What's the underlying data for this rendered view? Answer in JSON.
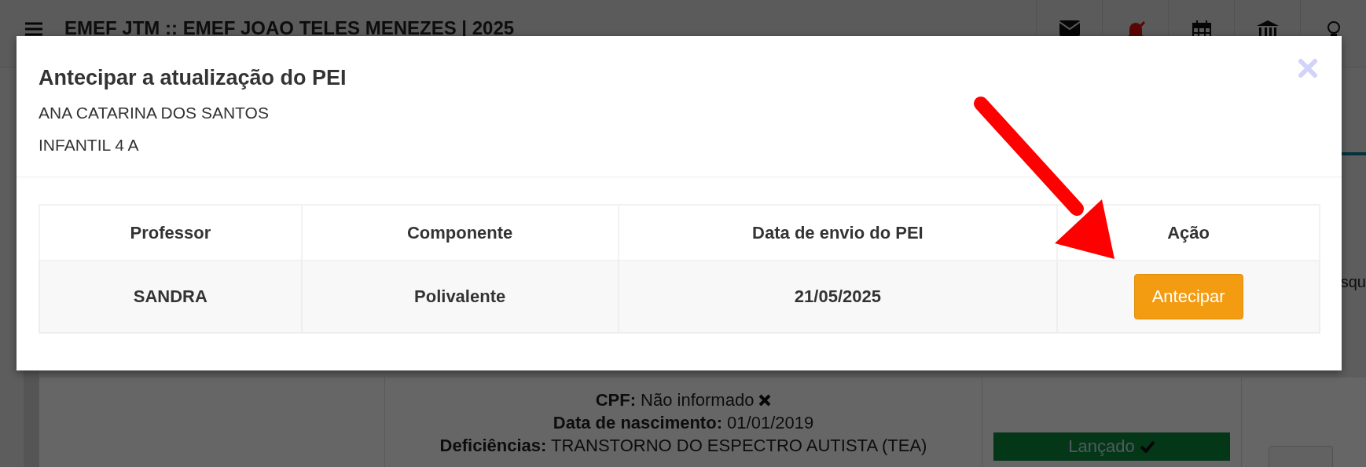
{
  "background_page": {
    "title": "EMEF JTM :: EMEF JOAO TELES MENEZES | 2025",
    "details": [
      "**CPF:** Não informado",
      "**Data de nascimento:** 01/01/2019",
      "**Deficiências:** TRANSTORNO DO ESPECTRO AUTISTA (TEA)"
    ],
    "status": "Lançado",
    "side_text": "squ"
  },
  "modal": {
    "title": "Antecipar a atualização do PEI",
    "student_name": "ANA CATARINA DOS SANTOS",
    "class": "INFANTIL 4 A",
    "table": {
      "columns": [
        "Professor",
        "Componente",
        "Data de envio do PEI",
        "Ação"
      ],
      "rows": [
        {
          "cells": [
            "SANDRA",
            "Polivalente",
            "21/05/2025"
          ],
          "action": "Antecipar"
        }
      ]
    }
  }
}
